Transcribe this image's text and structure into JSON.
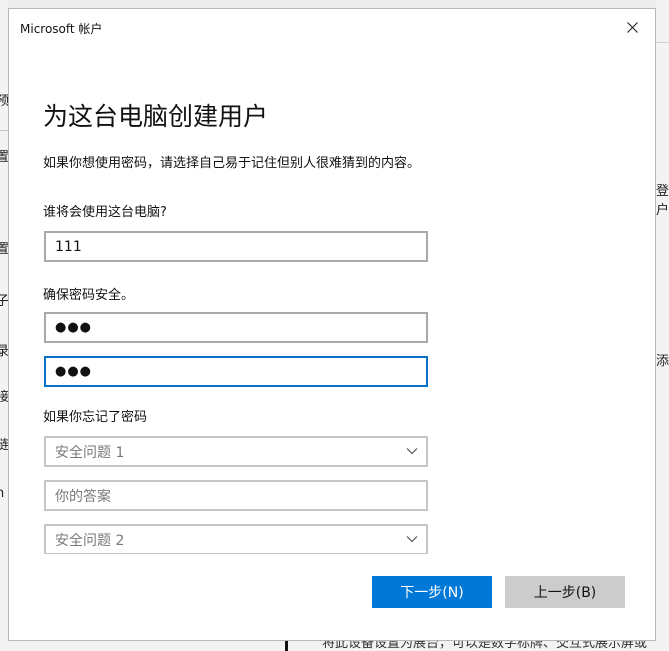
{
  "background": {
    "left_fragments": [
      "预",
      "置",
      "子",
      "录",
      "接",
      "链",
      "n"
    ],
    "right_fragments": [
      "登遥",
      "户过",
      "添"
    ],
    "bottom_text": "将此设备设置为展台，可以是数字标牌、交互式展示屏或"
  },
  "dialog": {
    "title": "Microsoft 帐户",
    "heading": "为这台电脑创建用户",
    "instruction": "如果你想使用密码，请选择自己易于记住但别人很难猜到的内容。",
    "username_label": "谁将会使用这台电脑?",
    "username_value": "111",
    "password_label": "确保密码安全。",
    "password_value": "●●●",
    "password_confirm_value": "●●●",
    "recovery_label": "如果你忘记了密码",
    "question1_placeholder": "安全问题 1",
    "answer1_placeholder": "你的答案",
    "question2_placeholder": "安全问题 2",
    "next_button": "下一步(N)",
    "back_button": "上一步(B)"
  },
  "colors": {
    "accent": "#0078d7",
    "focus_border": "#0a72c6",
    "secondary_button": "#cccccc"
  }
}
